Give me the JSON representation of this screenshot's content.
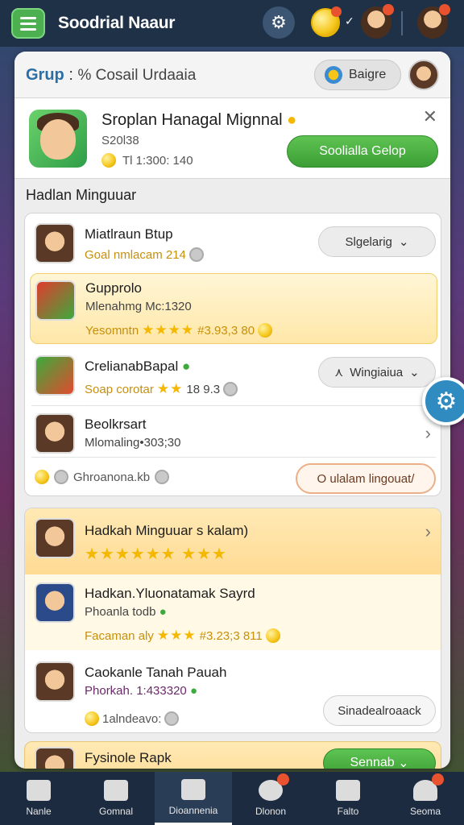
{
  "topbar": {
    "title": "Soodrial Naaur"
  },
  "panel": {
    "crumb_main": "Grup",
    "crumb_sep": ":",
    "crumb_sub": "% Cosail Urdaaia",
    "badge_label": "Baigre"
  },
  "group": {
    "name": "Sroplan Hanagal Mignnal",
    "meta": "S20l38",
    "members": "Tl 1:300: 140",
    "action": "Soolialla Gelop"
  },
  "section_title": "Hadlan Minguuar",
  "list1": {
    "rows": [
      {
        "title": "Miatlraun Btup",
        "gold": "Goal nmlacam 214",
        "pill": "Slgelarig"
      },
      {
        "title": "Gupprolo",
        "sub": "Mlenahmg Mc:1320",
        "gold": "Yesomntn",
        "score": "#3.93,3 80"
      },
      {
        "title": "CrelianabBapal",
        "gold": "Soap corotar",
        "score": "18 9.3",
        "pill": "Wingiaiua"
      },
      {
        "title": "Beolkrsart",
        "sub": "Mlomaling•303;30"
      },
      {
        "footer_text": "Ghroanona.kb",
        "footer_btn": "O ulalam lingouat/"
      }
    ]
  },
  "list2": {
    "rows": [
      {
        "title": "Hadkah Minguuar s kalam)"
      },
      {
        "title": "Hadkan.Yluonatamak Sayrd",
        "sub": "Phoanla todb",
        "gold": "Facaman aly",
        "score": "#3.23;3 811"
      },
      {
        "title": "Caokanle Tanah Pauah",
        "sub": "Phorkah. 1:433320",
        "footer_text": "1alndeavo:",
        "btn": "Sinadealroaack"
      }
    ]
  },
  "list3": {
    "title": "Fysinole Rapk",
    "btn": "Sennab"
  },
  "bottom_nav": [
    {
      "label": "Nanle"
    },
    {
      "label": "Gomnal"
    },
    {
      "label": "Dioannenia"
    },
    {
      "label": "Dlonon"
    },
    {
      "label": "Falto"
    },
    {
      "label": "Seoma"
    }
  ],
  "colors": {
    "accent_green": "#4caf50",
    "topbar": "#1f3147",
    "highlight": "#ffe7a8",
    "gold": "#f5c518"
  }
}
